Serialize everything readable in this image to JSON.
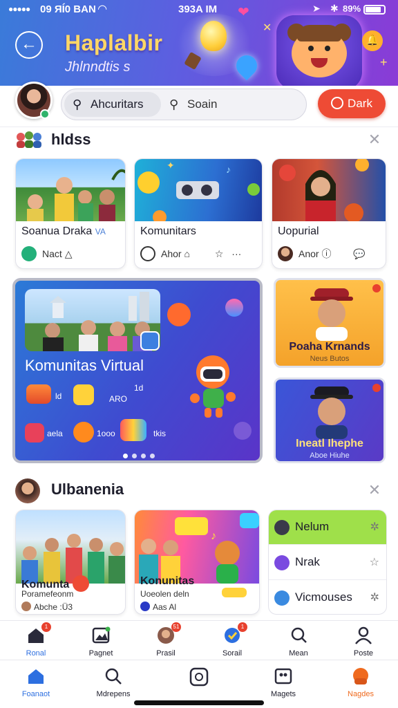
{
  "status_bar": {
    "carrier": "09 ЯÍ0 BAN",
    "time": "393A IM",
    "battery": "89%"
  },
  "header": {
    "title": "Haplalbir",
    "subtitle": "Jhlnndtis s"
  },
  "search": {
    "chip_label": "Ahcuritars",
    "search_label": "Soain",
    "dark_button": "Dark"
  },
  "section1": {
    "title": "hldss"
  },
  "cards_row1": [
    {
      "title": "Soanua Draka",
      "title_suffix": "VA",
      "meta": "Nact"
    },
    {
      "title": "Komunitars",
      "meta": "Ahor"
    },
    {
      "title": "Uopurial",
      "meta": "Anor"
    }
  ],
  "banner": {
    "title": "Komunitas Virtual",
    "label_1": "ld",
    "label_2": "ARO",
    "label_3": "1d",
    "label_4": "aela",
    "label_5": "1ooo",
    "label_6": "tkis"
  },
  "side_cards": [
    {
      "name": "Poaha Krnands",
      "sub": "Neus Butos"
    },
    {
      "name": "Ineatl Ihephe",
      "sub": "Aboe Hiuhe"
    }
  ],
  "section2": {
    "title": "Ulbanenia"
  },
  "cards_row2": [
    {
      "title": "Komunta",
      "sub": "Poramefeonm",
      "meta": "Abche :Ü3"
    },
    {
      "title": "Konunitas",
      "sub": "Uoeolen deln",
      "meta": "Aas Al"
    }
  ],
  "list_items": [
    {
      "label": "Nelum"
    },
    {
      "label": "Nrak"
    },
    {
      "label": "Vicmouses"
    }
  ],
  "nav_top": [
    {
      "label": "Ronal",
      "badge": "1"
    },
    {
      "label": "Pagnet",
      "badge": ""
    },
    {
      "label": "Prasil",
      "badge": "51"
    },
    {
      "label": "Sorail",
      "badge": "1"
    },
    {
      "label": "Mean",
      "badge": ""
    },
    {
      "label": "Poste",
      "badge": ""
    }
  ],
  "nav_bottom": [
    {
      "label": "Foanaot"
    },
    {
      "label": "Mdrepens"
    },
    {
      "label": ""
    },
    {
      "label": "Magets"
    },
    {
      "label": "Nagdes"
    }
  ],
  "colors": {
    "accent": "#ee4b35",
    "header_start": "#3a7bd9",
    "header_end": "#8a3bd6",
    "title_yellow": "#ffd766",
    "active_nav": "#2d6fe0",
    "active_nav_orange": "#ef6a1e"
  }
}
